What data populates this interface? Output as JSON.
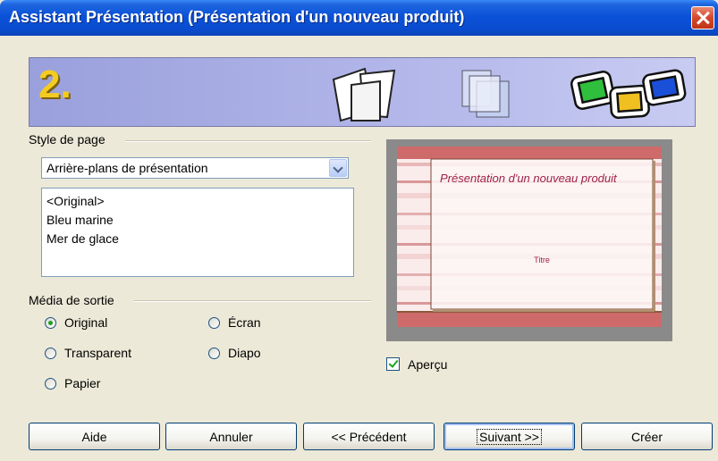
{
  "window": {
    "title": "Assistant Présentation (Présentation d'un nouveau produit)",
    "step_number": "2."
  },
  "page_style": {
    "group_label": "Style de page",
    "combo_value": "Arrière-plans de présentation",
    "templates": [
      "<Original>",
      "Bleu marine",
      "Mer de glace"
    ]
  },
  "output_media": {
    "group_label": "Média de sortie",
    "options": [
      "Original",
      "Écran",
      "Transparent",
      "Diapo",
      "Papier"
    ],
    "selected": "Original"
  },
  "preview": {
    "slide_title": "Présentation d'un nouveau produit",
    "slide_text": "Titre",
    "checkbox_label": "Aperçu",
    "checked": true
  },
  "buttons": {
    "help": "Aide",
    "cancel": "Annuler",
    "previous": "<< Précédent",
    "next": "Suivant >>",
    "create": "Créer"
  },
  "colors": {
    "titlebar": "#0a52d8",
    "banner": "#b4b8ea",
    "dialog_bg": "#ece9d8",
    "slide_title": "#a0204a"
  }
}
